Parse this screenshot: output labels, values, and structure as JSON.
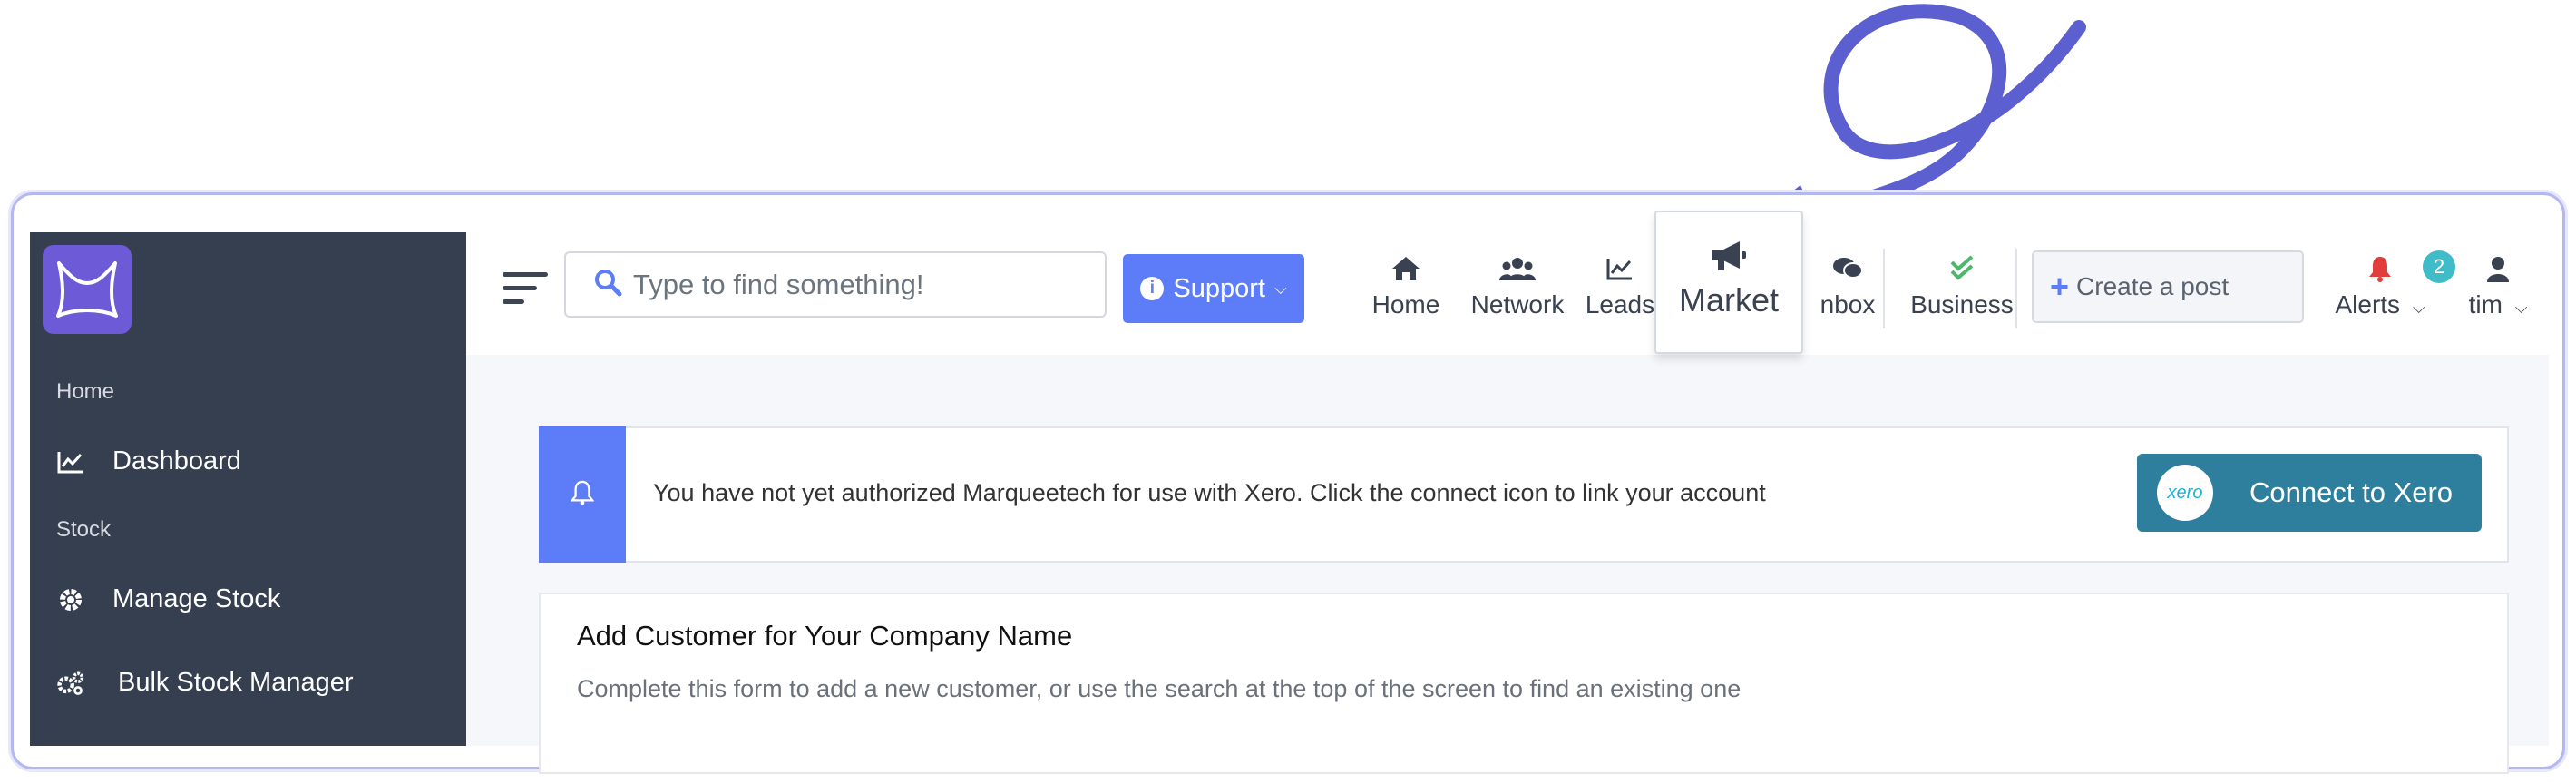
{
  "sidebar": {
    "sections": [
      {
        "label": "Home",
        "items": [
          {
            "label": "Dashboard",
            "icon": "chart-line-icon"
          }
        ]
      },
      {
        "label": "Stock",
        "items": [
          {
            "label": "Manage Stock",
            "icon": "gear-icon"
          },
          {
            "label": "Bulk Stock Manager",
            "icon": "gears-icon"
          }
        ]
      }
    ]
  },
  "topbar": {
    "search_placeholder": "Type to find something!",
    "support_label": "Support",
    "nav": [
      {
        "label": "Home",
        "icon": "home-icon"
      },
      {
        "label": "Network",
        "icon": "users-icon"
      },
      {
        "label": "Leads",
        "icon": "chart-line-icon"
      },
      {
        "label": "Market",
        "icon": "megaphone-icon"
      },
      {
        "label": "Inbox",
        "icon": "comments-icon",
        "visible_text": "nbox"
      },
      {
        "label": "Business",
        "icon": "check-double-icon"
      }
    ],
    "create_post_label": "Create a post",
    "alerts_label": "Alerts",
    "alerts_count": "2",
    "user_label": "tim"
  },
  "alert_banner": {
    "message": "You have not yet authorized Marqueetech for use with Xero. Click the connect icon to link your account",
    "button_label": "Connect to Xero",
    "xero_logo_text": "xero"
  },
  "customer_card": {
    "title": "Add Customer for Your Company Name",
    "subtitle": "Complete this form to add a new customer, or use the search at the top of the screen to find an existing one"
  },
  "colors": {
    "accent": "#5c7cf8",
    "sidebar_bg": "#363f4f",
    "logo_bg": "#6d5ad7",
    "arrow": "#5b5fd0",
    "xero_button": "#2e7f9e",
    "alert_bell": "#e23d3d",
    "business_check": "#4cb86a",
    "badge": "#3fbcc8"
  }
}
